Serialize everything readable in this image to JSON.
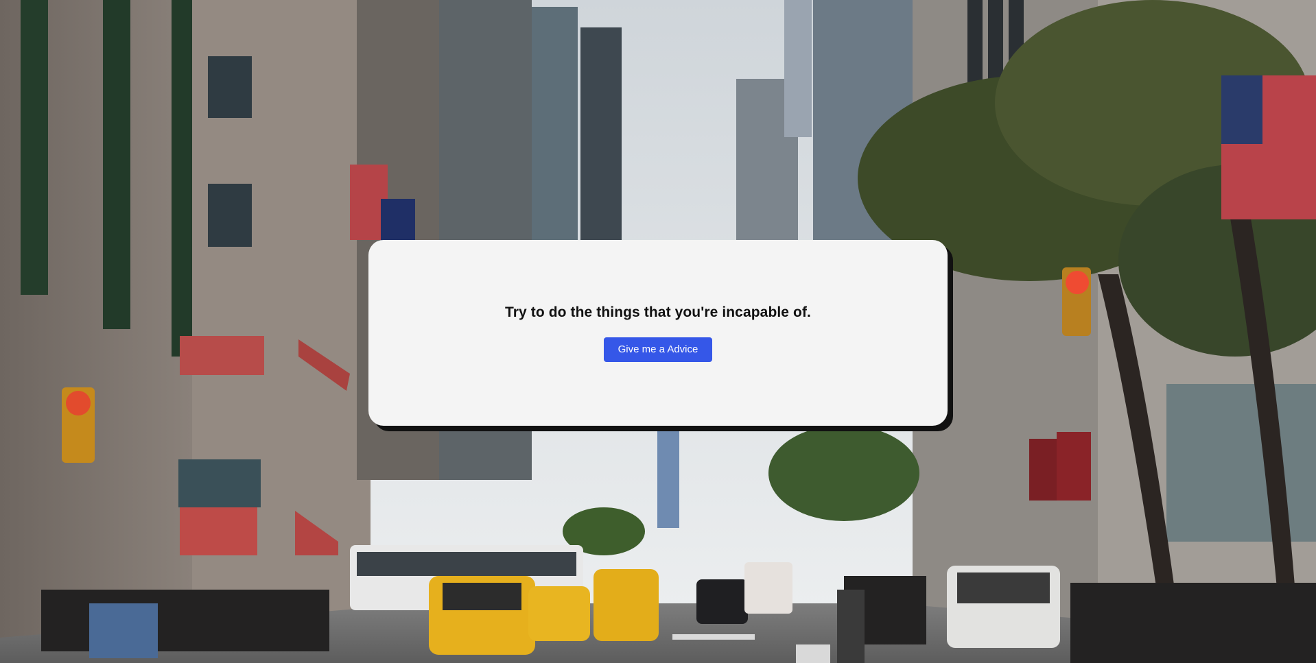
{
  "background": {
    "image": "city-street-photo",
    "colors": {
      "sky": "#dfe3e6",
      "taxi": "#e9b21c",
      "card": "#f4f4f4",
      "button": "#3557e8"
    }
  },
  "card": {
    "quote": "Try to do the things that you're incapable of.",
    "button_label": "Give me a Advice"
  }
}
